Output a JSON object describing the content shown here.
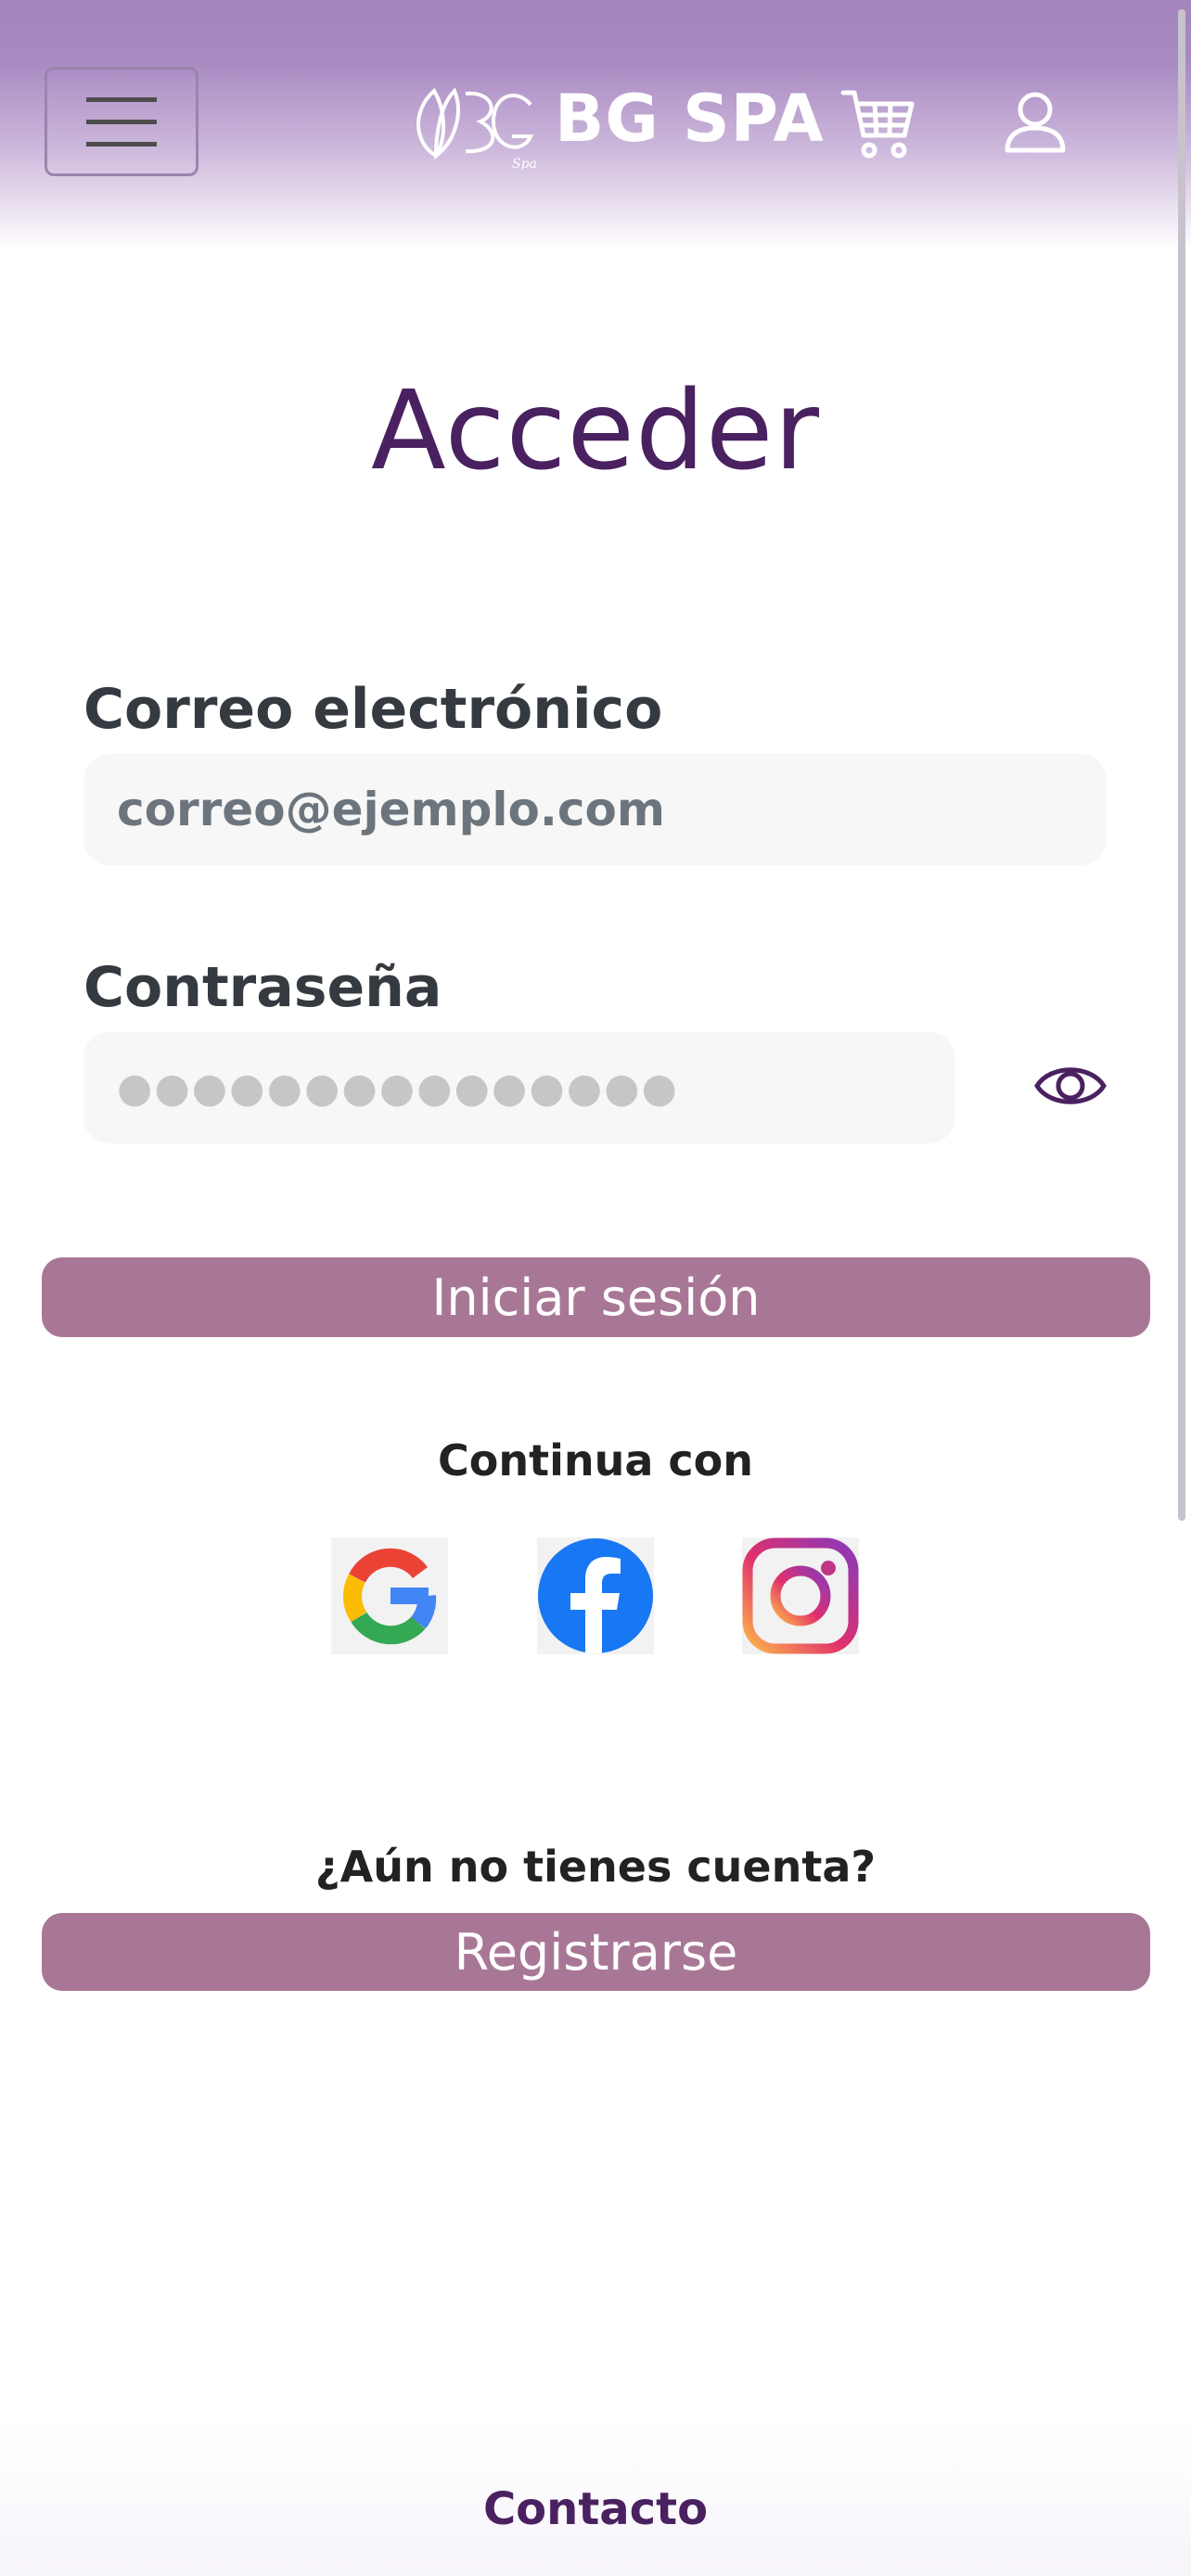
{
  "header": {
    "menu_icon": "hamburger-icon",
    "brand_name": "BG SPA",
    "logo_icon": "lotus-logo-icon",
    "cart_icon": "cart-icon",
    "user_icon": "user-icon"
  },
  "main": {
    "title": "Acceder",
    "email_label": "Correo electrónico",
    "email_placeholder": "correo@ejemplo.com",
    "password_label": "Contraseña",
    "password_value": "●●●●●●●●●●●●●●●",
    "show_password_icon": "eye-icon",
    "login_button": "Iniciar sesión",
    "social_heading": "Continua con",
    "social_providers": [
      "Google",
      "Facebook",
      "Instagram"
    ],
    "signup_prompt": "¿Aún no tienes cuenta?",
    "signup_button": "Registrarse"
  },
  "footer": {
    "contact": "Contacto"
  },
  "colors": {
    "header": "#a384bd",
    "title": "#4a2160",
    "button": "#a97796",
    "input_bg": "#f7f7f7"
  }
}
